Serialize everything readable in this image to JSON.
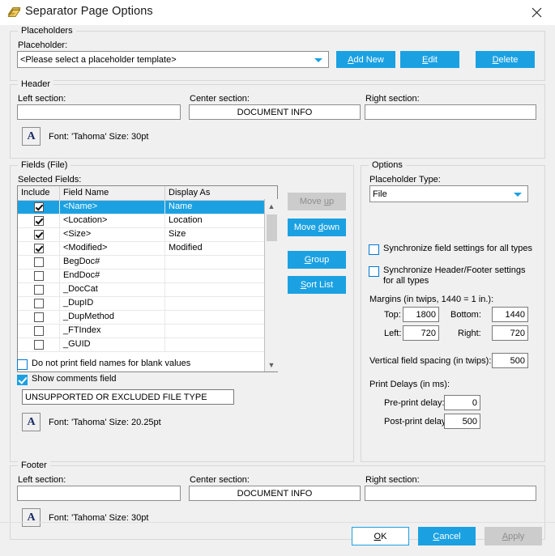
{
  "window": {
    "title": "Separator Page Options",
    "icon": "pages-stack-icon",
    "close_label": "✕",
    "accent_color": "#1ba1e2",
    "background_color": "#f0f0f0"
  },
  "placeholders": {
    "group_title": "Placeholders",
    "label": "Placeholder:",
    "combo_value": "<Please select a placeholder template>",
    "buttons": [
      {
        "name": "add-new",
        "label": "Add New",
        "accel": "A",
        "enabled": true
      },
      {
        "name": "edit",
        "label": "Edit",
        "accel": "E",
        "enabled": true
      },
      {
        "name": "delete",
        "label": "Delete",
        "accel": "D",
        "enabled": true
      }
    ]
  },
  "header": {
    "group_title": "Header",
    "left_label": "Left section:",
    "left_value": "",
    "center_label": "Center section:",
    "center_value": "DOCUMENT INFO",
    "right_label": "Right section:",
    "right_value": "",
    "font_button": "A",
    "font_text": "Font: 'Tahoma' Size: 30pt"
  },
  "fields": {
    "group_title": "Fields (File)",
    "selected_label": "Selected Fields:",
    "columns": [
      "Include",
      "Field Name",
      "Display As"
    ],
    "rows": [
      {
        "include": true,
        "field": "<Name>",
        "display": "Name",
        "selected": true
      },
      {
        "include": true,
        "field": "<Location>",
        "display": "Location",
        "selected": false
      },
      {
        "include": true,
        "field": "<Size>",
        "display": "Size",
        "selected": false
      },
      {
        "include": true,
        "field": "<Modified>",
        "display": "Modified",
        "selected": false
      },
      {
        "include": false,
        "field": "BegDoc#",
        "display": "",
        "selected": false
      },
      {
        "include": false,
        "field": "EndDoc#",
        "display": "",
        "selected": false
      },
      {
        "include": false,
        "field": "_DocCat",
        "display": "",
        "selected": false
      },
      {
        "include": false,
        "field": "_DupID",
        "display": "",
        "selected": false
      },
      {
        "include": false,
        "field": "_DupMethod",
        "display": "",
        "selected": false
      },
      {
        "include": false,
        "field": "_FTIndex",
        "display": "",
        "selected": false
      },
      {
        "include": false,
        "field": "_GUID",
        "display": "",
        "selected": false
      }
    ],
    "buttons": [
      {
        "name": "move-up",
        "label": "Move up",
        "accel": "u",
        "enabled": false
      },
      {
        "name": "move-down",
        "label": "Move down",
        "accel": "d",
        "enabled": true
      },
      {
        "name": "group",
        "label": "Group",
        "accel": "G",
        "enabled": true
      },
      {
        "name": "sort-list",
        "label": "Sort List",
        "accel": "S",
        "enabled": true
      }
    ],
    "no_blank_names_label": "Do not print field names for blank values",
    "no_blank_names_checked": false,
    "show_comments_label": "Show comments field",
    "show_comments_checked": true,
    "comments_value": "UNSUPPORTED OR EXCLUDED FILE TYPE",
    "comments_font_button": "A",
    "comments_font_text": "Font: 'Tahoma' Size: 20.25pt"
  },
  "options": {
    "group_title": "Options",
    "placeholder_type_label": "Placeholder Type:",
    "placeholder_type_value": "File",
    "sync_fields_label": "Synchronize field settings for all types",
    "sync_fields_checked": false,
    "sync_headerfooter_label": "Synchronize Header/Footer settings for all types",
    "sync_headerfooter_checked": false,
    "margins_label": "Margins (in twips, 1440 = 1 in.):",
    "margin_top_label": "Top:",
    "margin_top_value": "1800",
    "margin_bottom_label": "Bottom:",
    "margin_bottom_value": "1440",
    "margin_left_label": "Left:",
    "margin_left_value": "720",
    "margin_right_label": "Right:",
    "margin_right_value": "720",
    "vertical_spacing_label": "Vertical field spacing (in twips):",
    "vertical_spacing_value": "500",
    "print_delays_label": "Print Delays (in ms):",
    "pre_print_label": "Pre-print delay:",
    "pre_print_value": "0",
    "post_print_label": "Post-print delay:",
    "post_print_value": "500"
  },
  "footer": {
    "group_title": "Footer",
    "left_label": "Left section:",
    "left_value": "",
    "center_label": "Center section:",
    "center_value": "DOCUMENT INFO",
    "right_label": "Right section:",
    "right_value": "",
    "font_button": "A",
    "font_text": "Font: 'Tahoma' Size: 30pt"
  },
  "actions": [
    {
      "name": "ok",
      "label": "OK",
      "accel": "O",
      "style": "light",
      "enabled": true
    },
    {
      "name": "cancel",
      "label": "Cancel",
      "accel": "C",
      "style": "primary",
      "enabled": true
    },
    {
      "name": "apply",
      "label": "Apply",
      "accel": "A",
      "style": "disabled",
      "enabled": false
    }
  ]
}
